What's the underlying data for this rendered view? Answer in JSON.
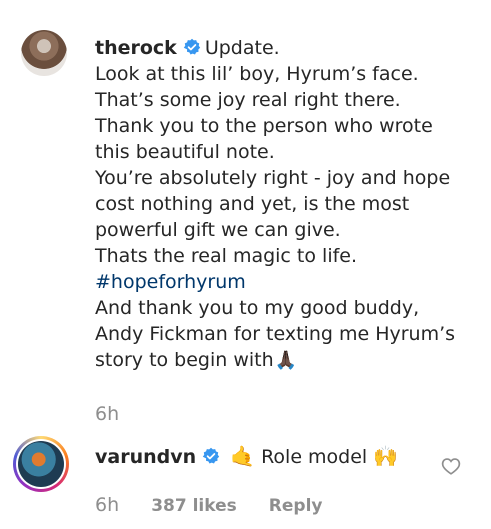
{
  "comments": [
    {
      "username": "therock",
      "lines": [
        "Update.",
        "Look at this lil’ boy, Hyrum’s face.",
        "That’s some joy real right there.",
        "Thank you to the person who wrote",
        "this beautiful note.",
        "You’re absolutely right - joy and hope",
        "cost nothing and yet, is the most",
        "powerful gift we can give.",
        "Thats the real magic to life.",
        "#hopeforhyrum",
        "And thank you to my good buddy,",
        "Andy Fickman for texting me Hyrum’s",
        "story to begin with"
      ],
      "emoji_end": "🙏🏿",
      "time": "6h"
    },
    {
      "username": "varundvn",
      "emoji_start": "🤙",
      "text": "Role model",
      "emoji_end": "🙌",
      "time": "6h",
      "likes": "387 likes",
      "reply_label": "Reply"
    }
  ],
  "colors": {
    "text": "#262626",
    "muted": "#8e8e8e",
    "hashtag": "#00376b",
    "verified": "#3897f0"
  },
  "icons": [
    "verified-badge-icon",
    "heart-icon"
  ]
}
